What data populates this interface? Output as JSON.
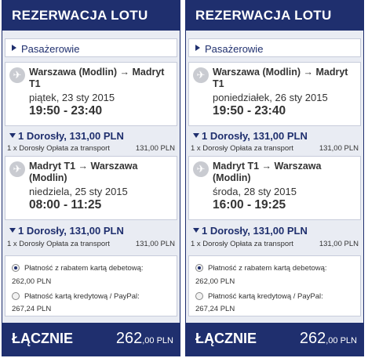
{
  "panels": [
    {
      "header": "REZERWACJA LOTU",
      "passengers_label": "Pasażerowie",
      "flights": [
        {
          "route": "Warszawa (Modlin) → Madryt T1",
          "date": "piątek, 23 sty 2015",
          "time": "19:50 - 23:40",
          "price_summary": "1 Dorosły, 131,00 PLN",
          "detail_label": "1 x Dorosły Opłata za transport",
          "detail_amount": "131,00 PLN"
        },
        {
          "route": "Madryt T1 → Warszawa (Modlin)",
          "date": "niedziela, 25 sty 2015",
          "time": "08:00 - 11:25",
          "price_summary": "1 Dorosły, 131,00 PLN",
          "detail_label": "1 x Dorosły Opłata za transport",
          "detail_amount": "131,00 PLN"
        }
      ],
      "payment": [
        {
          "label": "Płatność z rabatem kartą debetową:",
          "amount": "262,00 PLN",
          "selected": true
        },
        {
          "label": "Płatność kartą kredytową / PayPal:",
          "amount": "267,24 PLN",
          "selected": false
        }
      ],
      "total_label": "ŁĄCZNIE",
      "total_main": "262",
      "total_decimals": ",00 PLN"
    },
    {
      "header": "REZERWACJA LOTU",
      "passengers_label": "Pasażerowie",
      "flights": [
        {
          "route": "Warszawa (Modlin) → Madryt T1",
          "date": "poniedziałek, 26 sty 2015",
          "time": "19:50 - 23:40",
          "price_summary": "1 Dorosły, 131,00 PLN",
          "detail_label": "1 x Dorosły Opłata za transport",
          "detail_amount": "131,00 PLN"
        },
        {
          "route": "Madryt T1 → Warszawa (Modlin)",
          "date": "środa, 28 sty 2015",
          "time": "16:00 - 19:25",
          "price_summary": "1 Dorosły, 131,00 PLN",
          "detail_label": "1 x Dorosły Opłata za transport",
          "detail_amount": "131,00 PLN"
        }
      ],
      "payment": [
        {
          "label": "Płatność z rabatem kartą debetową:",
          "amount": "262,00 PLN",
          "selected": true
        },
        {
          "label": "Płatność kartą kredytową / PayPal:",
          "amount": "267,24 PLN",
          "selected": false
        }
      ],
      "total_label": "ŁĄCZNIE",
      "total_main": "262",
      "total_decimals": ",00 PLN"
    }
  ],
  "icons": {
    "plane": "airplane-icon",
    "expand": "triangle-right-icon",
    "collapse": "triangle-down-icon"
  },
  "colors": {
    "brand": "#1f2f6e",
    "background": "#e9ecf3"
  }
}
